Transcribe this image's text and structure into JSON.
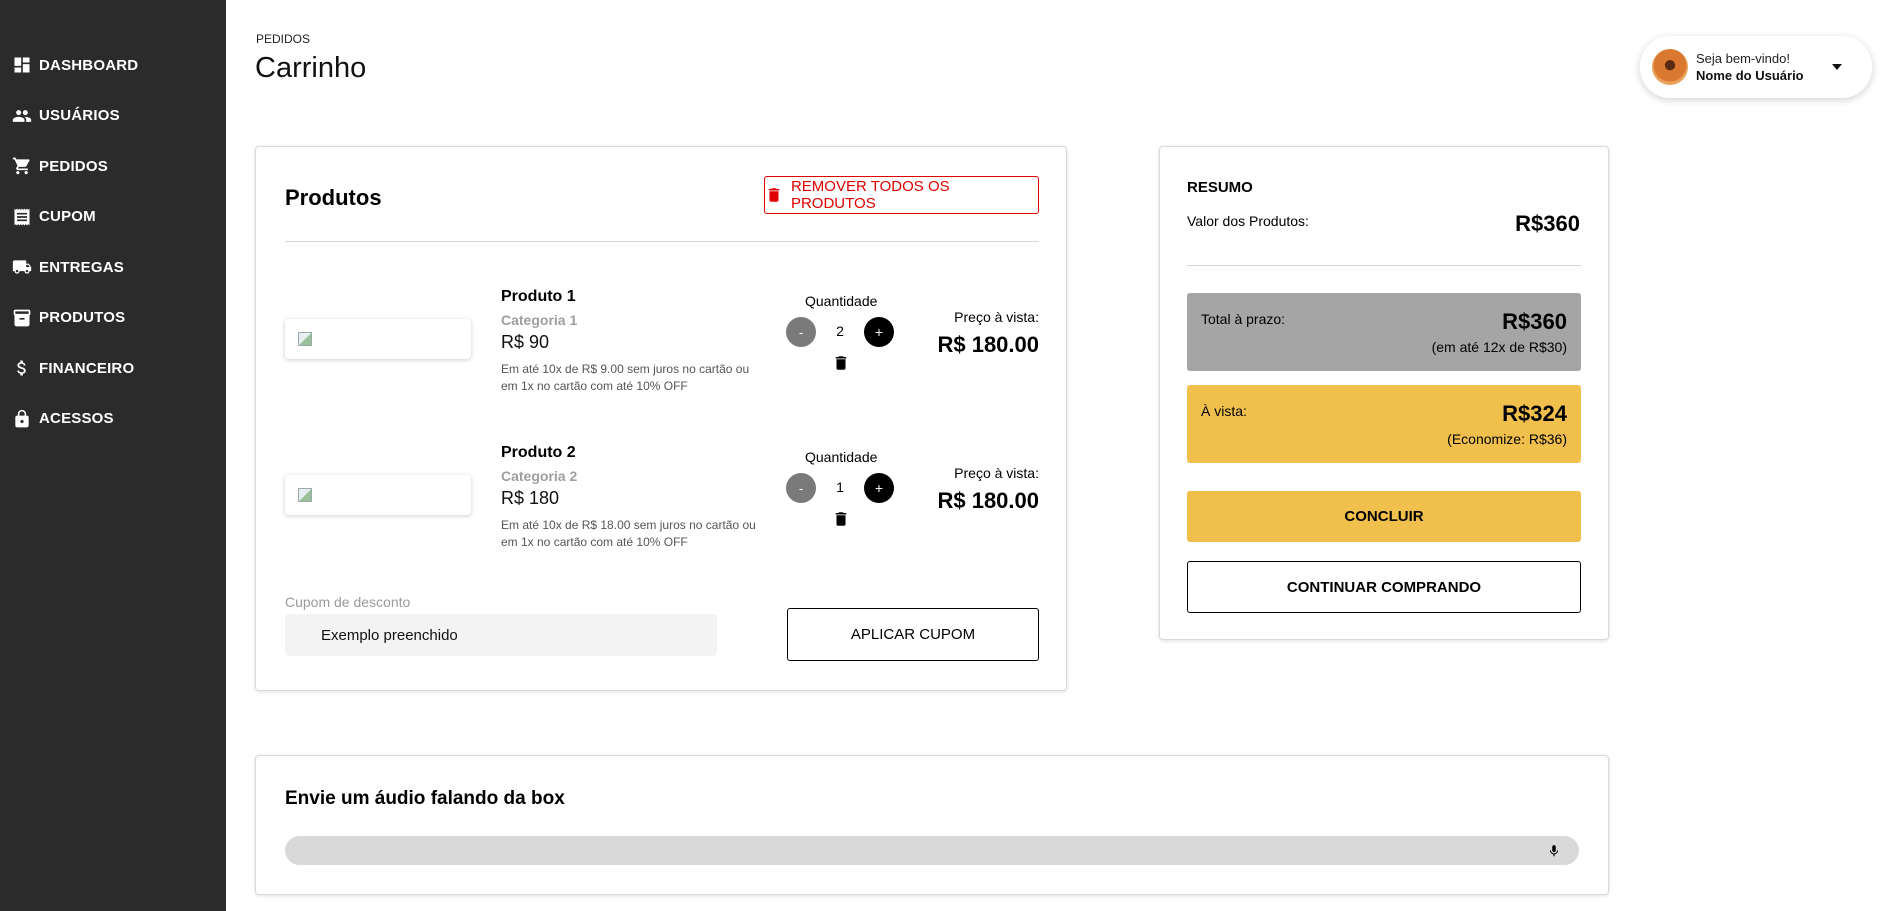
{
  "sidebar": {
    "items": [
      {
        "label": "DASHBOARD",
        "icon": "dashboard-icon"
      },
      {
        "label": "USUÁRIOS",
        "icon": "users-icon"
      },
      {
        "label": "PEDIDOS",
        "icon": "cart-icon"
      },
      {
        "label": "CUPOM",
        "icon": "receipt-icon"
      },
      {
        "label": "ENTREGAS",
        "icon": "truck-icon"
      },
      {
        "label": "PRODUTOS",
        "icon": "box-icon"
      },
      {
        "label": "FINANCEIRO",
        "icon": "dollar-icon"
      },
      {
        "label": "ACESSOS",
        "icon": "lock-icon"
      }
    ]
  },
  "header": {
    "breadcrumb": "PEDIDOS",
    "title": "Carrinho"
  },
  "user": {
    "welcome": "Seja bem-vindo!",
    "name": "Nome do Usuário"
  },
  "products": {
    "title": "Produtos",
    "remove_all_label": "REMOVER TODOS OS PRODUTOS",
    "quantity_label": "Quantidade",
    "cash_price_label": "Preço à vista:",
    "items": [
      {
        "name": "Produto 1",
        "category": "Categoria 1",
        "price": "R$ 90",
        "installments": "Em até 10x de R$ 9.00 sem juros no cartão ou em 1x no cartão com até 10% OFF",
        "quantity": "2",
        "cash_price": "R$ 180.00"
      },
      {
        "name": "Produto 2",
        "category": "Categoria 2",
        "price": "R$ 180",
        "installments": "Em até 10x de R$ 18.00 sem juros no cartão ou em 1x no cartão com até 10% OFF",
        "quantity": "1",
        "cash_price": "R$ 180.00"
      }
    ],
    "minus_label": "-",
    "plus_label": "+",
    "coupon": {
      "label": "Cupom de desconto",
      "value": "Exemplo preenchido",
      "apply_label": "APLICAR CUPOM"
    }
  },
  "summary": {
    "title": "RESUMO",
    "products_value_label": "Valor dos Produtos:",
    "products_value": "R$360",
    "term_label": "Total à prazo:",
    "term_value": "R$360",
    "term_sub": "(em até 12x de R$30)",
    "cash_label": "À vista:",
    "cash_value": "R$324",
    "cash_sub": "(Economize: R$36)",
    "conclude_label": "CONCLUIR",
    "continue_label": "CONTINUAR COMPRANDO"
  },
  "audio": {
    "title": "Envie um áudio falando da box"
  },
  "colors": {
    "sidebar_bg": "#2b2b2b",
    "accent_yellow": "#f0bf4c",
    "danger_red": "#e00000",
    "term_box_gray": "#a5a5a5"
  }
}
